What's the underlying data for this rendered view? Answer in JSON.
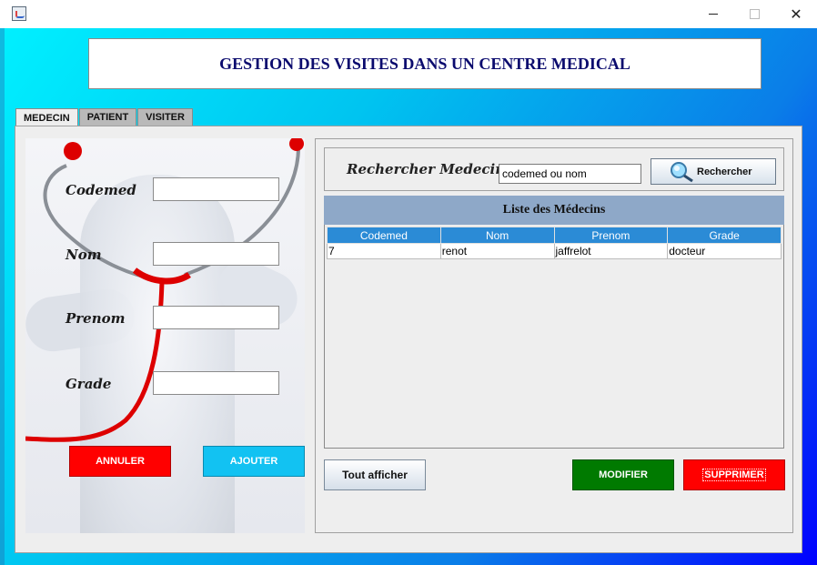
{
  "window": {
    "controls": {
      "minimize": "",
      "maximize": "",
      "close": "✕"
    }
  },
  "header": {
    "title": "GESTION DES VISITES DANS UN CENTRE MEDICAL"
  },
  "tabs": [
    {
      "label": "MEDECIN",
      "active": true
    },
    {
      "label": "PATIENT",
      "active": false
    },
    {
      "label": "VISITER",
      "active": false
    }
  ],
  "form": {
    "codemed": {
      "label": "Codemed",
      "value": ""
    },
    "nom": {
      "label": "Nom",
      "value": ""
    },
    "prenom": {
      "label": "Prenom",
      "value": ""
    },
    "grade": {
      "label": "Grade",
      "value": ""
    },
    "annuler_label": "ANNULER",
    "ajouter_label": "AJOUTER"
  },
  "search": {
    "label": "Rechercher Medecin",
    "value": "codemed ou nom",
    "button_label": "Rechercher"
  },
  "list": {
    "title": "Liste des Médecins",
    "columns": [
      "Codemed",
      "Nom",
      "Prenom",
      "Grade"
    ],
    "rows": [
      [
        "7",
        "renot",
        "jaffrelot",
        "docteur"
      ]
    ]
  },
  "actions": {
    "tout_afficher_label": "Tout afficher",
    "modifier_label": "MODIFIER",
    "supprimer_label": "SUPPRIMER"
  },
  "colors": {
    "annuler": "#ff0000",
    "ajouter": "#12c2f2",
    "modifier": "#007a00",
    "supprimer": "#ff0000",
    "table_header": "#2b8bd6",
    "list_header": "#8ea8c8"
  }
}
